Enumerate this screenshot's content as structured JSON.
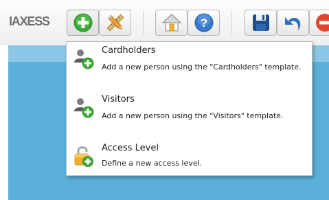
{
  "app": {
    "logo_text": "IAXESS"
  },
  "toolbar": {
    "buttons": [
      {
        "name": "add",
        "icon": "plus-circle-icon",
        "color": "#3aa935",
        "active": true
      },
      {
        "name": "tools",
        "icon": "pencil-ruler-icon",
        "color": "#e8a23a",
        "active": false
      },
      {
        "name": "home",
        "icon": "home-icon",
        "color": "#f2b02b",
        "active": false
      },
      {
        "name": "help",
        "icon": "help-icon",
        "color": "#3a78c9",
        "active": false
      },
      {
        "name": "save",
        "icon": "save-icon",
        "color": "#1e4f8a",
        "active": false
      },
      {
        "name": "undo",
        "icon": "undo-icon",
        "color": "#2e6fb8",
        "active": false
      },
      {
        "name": "cancel",
        "icon": "cancel-icon",
        "color": "#e0452e",
        "active": false
      }
    ]
  },
  "menu": {
    "items": [
      {
        "icon": "person-add-icon",
        "title": "Cardholders",
        "description": "Add a new person using the \"Cardholders\" template."
      },
      {
        "icon": "person-add-icon",
        "title": "Visitors",
        "description": "Add a new person using the \"Visitors\" template."
      },
      {
        "icon": "lock-add-icon",
        "title": "Access Level",
        "description": "Define a new access level."
      }
    ]
  },
  "colors": {
    "content_bg": "#5bb0d9",
    "accent_green": "#3aa935"
  }
}
